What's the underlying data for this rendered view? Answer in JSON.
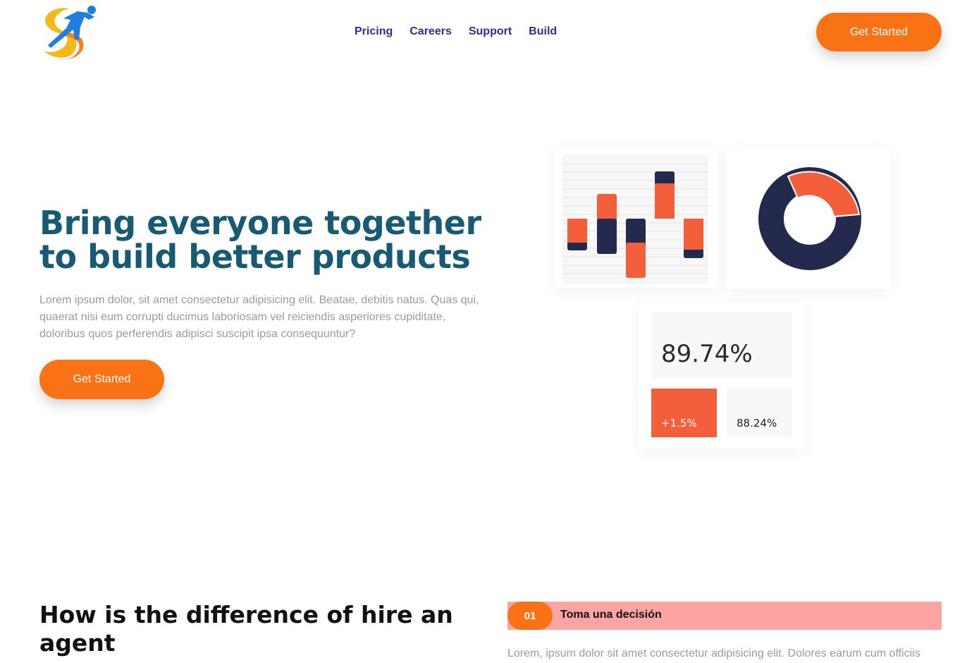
{
  "nav": {
    "items": [
      {
        "label": "Pricing"
      },
      {
        "label": "Careers"
      },
      {
        "label": "Support"
      },
      {
        "label": "Build"
      }
    ]
  },
  "header": {
    "cta_label": "Get Started"
  },
  "hero": {
    "title": "Bring everyone together to build better products",
    "text": "Lorem ipsum dolor, sit amet consectetur adipisicing elit. Beatae, debitis natus. Quas qui, quaerat nisi eum corrupti ducimus laboriosam vel reiciendis asperiores cupiditate, doloribus quos perferendis adipisci suscipit ipsa consequuntur?",
    "cta_label": "Get Started"
  },
  "dashboard": {
    "stat_main": "89.74%",
    "stat_change": "+1.5%",
    "stat_secondary": "88.24%"
  },
  "colors": {
    "accent_orange": "#f97316",
    "chart_orange": "#f25f3a",
    "chart_navy": "#232a4d",
    "title_teal": "#175a73",
    "nav_blue": "#2e2e8f",
    "step_pink": "#fba4a2"
  },
  "section": {
    "title": "How is the difference of hire an agent",
    "step": {
      "number": "01",
      "label": "Toma una decisión",
      "text": "Lorem, ipsum dolor sit amet consectetur adipisicing elit. Dolores earum cum officiis"
    }
  }
}
